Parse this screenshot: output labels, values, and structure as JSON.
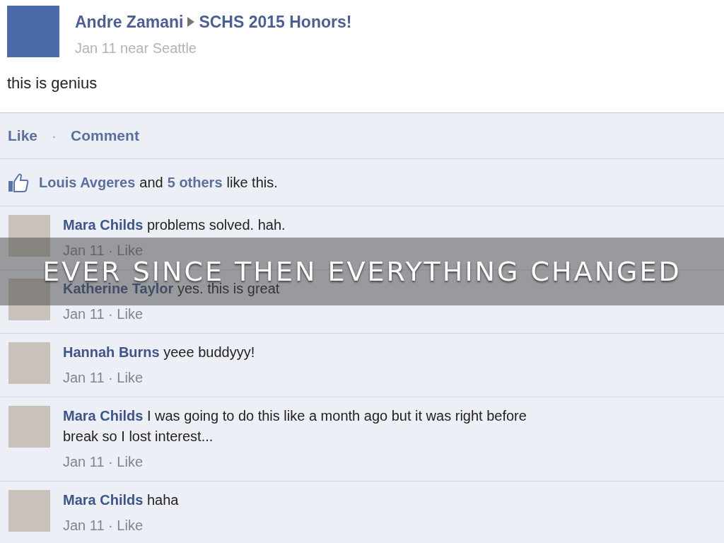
{
  "post": {
    "author": "Andre Zamani",
    "target": "SCHS 2015 Honors!",
    "meta": "Jan 11 near Seattle",
    "text": "this is genius"
  },
  "actions": [
    {
      "label": "Like"
    },
    {
      "label": "Comment"
    }
  ],
  "action_separator": "·",
  "likes": [
    {
      "kind": "link",
      "text": "Louis Avgeres"
    },
    {
      "kind": "plain",
      "text": "and"
    },
    {
      "kind": "link",
      "text": "5 others"
    },
    {
      "kind": "plain",
      "text": "like this."
    }
  ],
  "comments": [
    {
      "name": "Mara Childs",
      "text": "problems solved. hah.",
      "meta": "Jan 11 · Like"
    },
    {
      "name": "Katherine Taylor",
      "text": "yes. this is great",
      "meta": "Jan 11 · Like"
    },
    {
      "name": "Hannah Burns",
      "text": "yeee buddyyy!",
      "meta": "Jan 11 · Like"
    },
    {
      "name": "Mara Childs",
      "text": "I was going to do this like a month ago but it was right before break so I lost interest...",
      "meta": "Jan 11 · Like"
    },
    {
      "name": "Mara Childs",
      "text": "haha",
      "meta": "Jan 11 · Like"
    }
  ],
  "banner": {
    "text": "EVER SINCE THEN EVERYTHING CHANGED"
  }
}
